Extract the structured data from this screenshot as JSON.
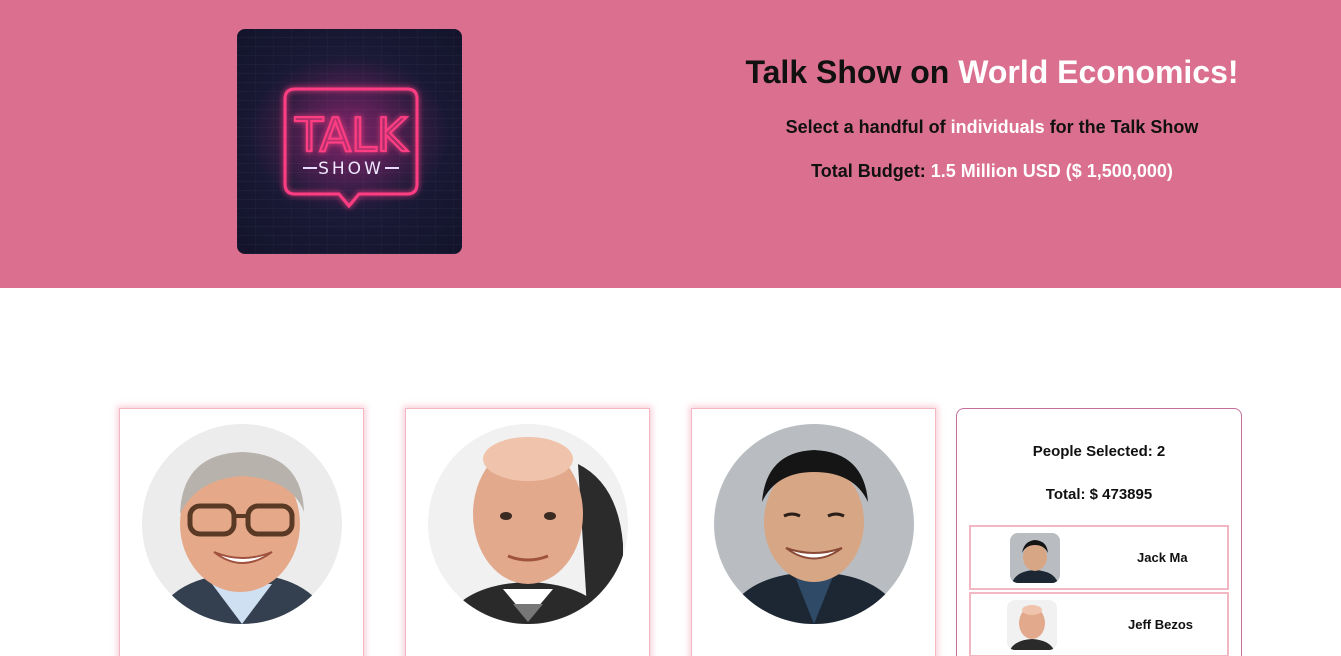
{
  "header": {
    "logo": {
      "top_text": "TALK",
      "bottom_text": "SHOW"
    },
    "title": {
      "prefix": "Talk Show on ",
      "highlight": "World Economics!"
    },
    "subtitle": {
      "prefix": "Select a handful of ",
      "highlight": "individuals",
      "suffix": " for the Talk Show"
    },
    "budget": {
      "label": "Total Budget: ",
      "value": "1.5 Million USD ($ 1,500,000)"
    }
  },
  "cards": [
    {
      "person": "bill-gates"
    },
    {
      "person": "jeff-bezos"
    },
    {
      "person": "jack-ma"
    }
  ],
  "summary": {
    "people_selected": "People Selected: 2",
    "total": "Total: $ 473895",
    "selected": [
      {
        "name": "Jack Ma"
      },
      {
        "name": "Jeff Bezos"
      }
    ]
  },
  "colors": {
    "header_bg": "#db6f8f",
    "highlight": "#ffffff",
    "card_border": "#f3b7c3",
    "summary_border": "#c66e9b"
  }
}
